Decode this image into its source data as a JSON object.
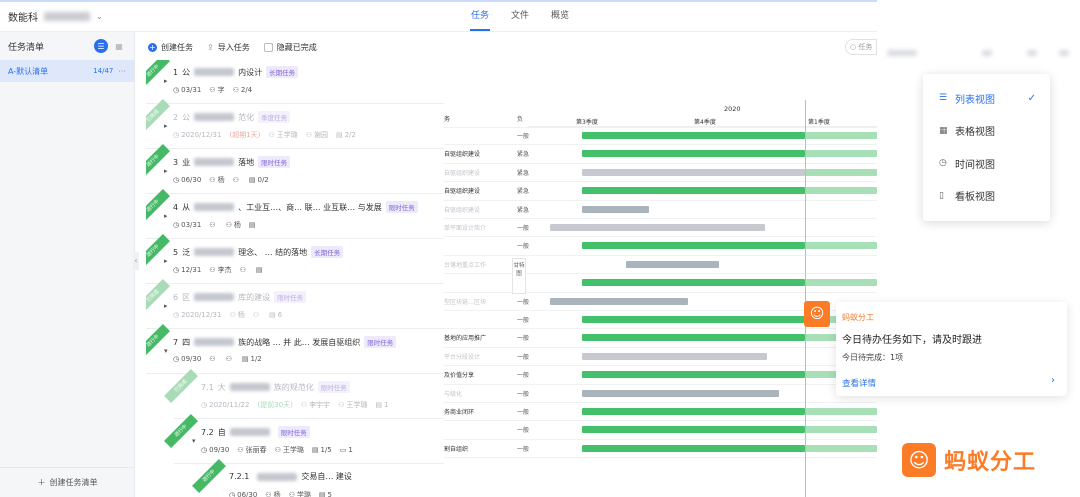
{
  "topbar": {
    "project_name": "数能科",
    "tabs": [
      {
        "label": "任务",
        "active": true
      },
      {
        "label": "文件",
        "active": false
      },
      {
        "label": "概览",
        "active": false
      }
    ]
  },
  "sidebar": {
    "title": "任务清单",
    "items": [
      {
        "label": "A-默认清单",
        "count": "14/47"
      }
    ],
    "footer_label": "创建任务清单"
  },
  "toolbar": {
    "create_label": "创建任务",
    "import_label": "导入任务",
    "hide_done_label": "隐藏已完成",
    "search_placeholder": "任务"
  },
  "tasks": [
    {
      "ribbon": "进行中",
      "done": false,
      "caret": "▸",
      "number": "1",
      "title_a": "公",
      "title_b": "内设计",
      "tag": "长期任务",
      "meta": [
        "03/31",
        "字",
        "2/4"
      ],
      "due_note": ""
    },
    {
      "ribbon": "已完成",
      "done": true,
      "caret": "▸",
      "number": "2",
      "title_a": "公",
      "title_b": "范化",
      "tag": "季度任务",
      "meta": [
        "2020/12/31",
        "王学璐",
        "谢园",
        "2/2"
      ],
      "due_note": "(超期1天)"
    },
    {
      "ribbon": "进行中",
      "done": false,
      "caret": "▸",
      "number": "3",
      "title_a": "业",
      "title_b": "落地",
      "tag": "限时任务",
      "meta": [
        "06/30",
        "杨",
        "",
        "0/2"
      ],
      "due_note": ""
    },
    {
      "ribbon": "进行中",
      "done": false,
      "caret": "▸",
      "number": "4",
      "title_a": "从",
      "title_b": "、工业互…、商… 联… 业互联… 与发展",
      "tag": "限时任务",
      "meta": [
        "03/31",
        "",
        "杨",
        ""
      ],
      "due_note": ""
    },
    {
      "ribbon": "进行中",
      "done": false,
      "caret": "▸",
      "number": "5",
      "title_a": "泛",
      "title_b": "理念、 … 结的落地",
      "tag": "长期任务",
      "meta": [
        "12/31",
        "李杰",
        "",
        ""
      ],
      "due_note": ""
    },
    {
      "ribbon": "已完成",
      "done": true,
      "caret": "▸",
      "number": "6",
      "title_a": "区",
      "title_b": "库的建设",
      "tag": "限时任务",
      "meta": [
        "2020/12/31",
        "杨",
        "",
        "6"
      ],
      "due_note": ""
    },
    {
      "ribbon": "进行中",
      "done": false,
      "caret": "▾",
      "number": "7",
      "title_a": "四",
      "title_b": "族的战略 … 并 此… 发展自驱组织",
      "tag": "限时任务",
      "meta": [
        "09/30",
        "",
        "",
        "1/2"
      ],
      "due_note": ""
    },
    {
      "ribbon": "已完成",
      "done": true,
      "caret": "",
      "number": "7.1",
      "title_a": "大",
      "title_b": "族的规范化",
      "tag": "限时任务",
      "meta": [
        "2020/11/22",
        "李宇宇",
        "王学璐",
        "1"
      ],
      "due_note": "(提前30天)"
    },
    {
      "ribbon": "进行中",
      "done": false,
      "caret": "▾",
      "number": "7.2",
      "title_a": "自",
      "title_b": "",
      "tag": "限时任务",
      "meta": [
        "09/30",
        "张丽春",
        "王学璐",
        "1/5",
        "1"
      ],
      "due_note": ""
    },
    {
      "ribbon": "进行中",
      "done": false,
      "caret": "",
      "number": "7.2.1",
      "title_a": "",
      "title_b": "交易自… 建设",
      "tag": "",
      "meta": [
        "06/30",
        "杨",
        "学璐",
        "5"
      ],
      "due_note": ""
    }
  ],
  "gantt": {
    "year": "2020",
    "quarters": [
      "第3季度",
      "第4季度",
      "第1季度"
    ],
    "vertical_tab": "甘特图",
    "rows": [
      {
        "name": "务",
        "owner": "负",
        "faded": false
      },
      {
        "name": "",
        "owner": "一般",
        "faded": false
      },
      {
        "name": "自驱组织建设",
        "owner": "紧急",
        "faded": false
      },
      {
        "name": "自驱组织建设",
        "owner": "紧急",
        "faded": true
      },
      {
        "name": "自驱组织建设",
        "owner": "紧急",
        "faded": false
      },
      {
        "name": "自驱组织建设",
        "owner": "紧急",
        "faded": true
      },
      {
        "name": "单平面设计简介",
        "owner": "一般",
        "faded": true
      },
      {
        "name": "",
        "owner": "一般",
        "faded": false
      },
      {
        "name": "台落地重点工作",
        "owner": "",
        "faded": true
      },
      {
        "name": "",
        "owner": "",
        "faded": false
      },
      {
        "name": "型区块链…区块",
        "owner": "一般",
        "faded": true
      },
      {
        "name": "",
        "owner": "一般",
        "faded": false
      },
      {
        "name": "基地的应用推广",
        "owner": "一般",
        "faded": false
      },
      {
        "name": "平台分段设计",
        "owner": "一般",
        "faded": true
      },
      {
        "name": "及价值分享",
        "owner": "一般",
        "faded": false
      },
      {
        "name": "与级化",
        "owner": "一般",
        "faded": true
      },
      {
        "name": "务商业闭环",
        "owner": "一般",
        "faded": false
      },
      {
        "name": "",
        "owner": "一般",
        "faded": false
      },
      {
        "name": "割自组织",
        "owner": "一般",
        "faded": false
      }
    ]
  },
  "view_menu": {
    "items": [
      {
        "label": "列表视图",
        "icon": "list-view-icon",
        "glyph": "☰",
        "active": true
      },
      {
        "label": "表格视图",
        "icon": "table-view-icon",
        "glyph": "▦",
        "active": false
      },
      {
        "label": "时间视图",
        "icon": "clock-icon",
        "glyph": "◷",
        "active": false
      },
      {
        "label": "看板视图",
        "icon": "kanban-icon",
        "glyph": "▯",
        "active": false
      }
    ],
    "check": "✓"
  },
  "notification": {
    "app": "蚂蚁分工",
    "title": "今日待办任务如下，请及时跟进",
    "subtitle": "今日待完成：1项",
    "link": "查看详情"
  },
  "brand": {
    "name": "蚂蚁分工",
    "color": "#fb7b27"
  },
  "colors": {
    "accent": "#2a6ff0",
    "green": "#45c06a",
    "tag_purple": "#7d63d8",
    "warn": "#e0563f"
  }
}
